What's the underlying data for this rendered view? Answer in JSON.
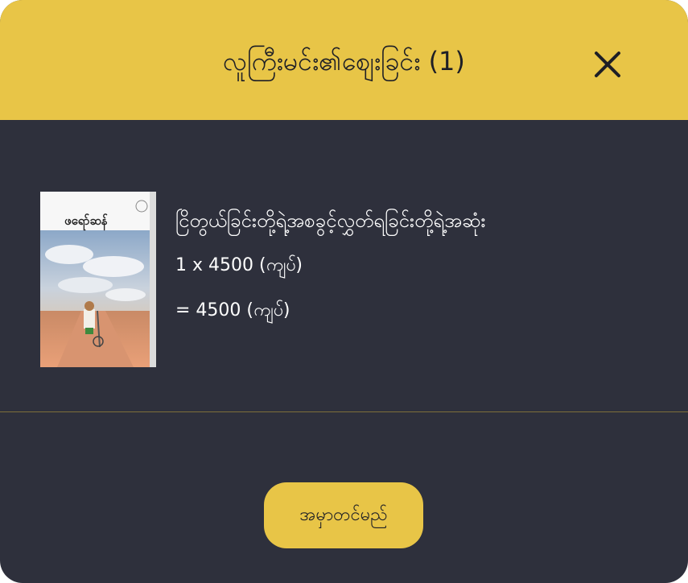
{
  "header": {
    "title": "လူကြီးမင်း၏စျေးခြင်း (1)",
    "close_icon": "close-icon"
  },
  "cart": {
    "items": [
      {
        "cover_author": "ဖရော်ဆန်",
        "name": "ငြိတွယ်ခြင်းတို့ရဲ့အစခွင့်လွှတ်ရခြင်းတို့ရဲ့အဆုံး",
        "qty_price": "1 x 4500 (ကျပ်)",
        "subtotal": "= 4500 (ကျပ်)"
      }
    ]
  },
  "actions": {
    "order_label": "အမှာတင်မည်"
  },
  "colors": {
    "accent": "#e8c547",
    "background": "#2e303c"
  }
}
